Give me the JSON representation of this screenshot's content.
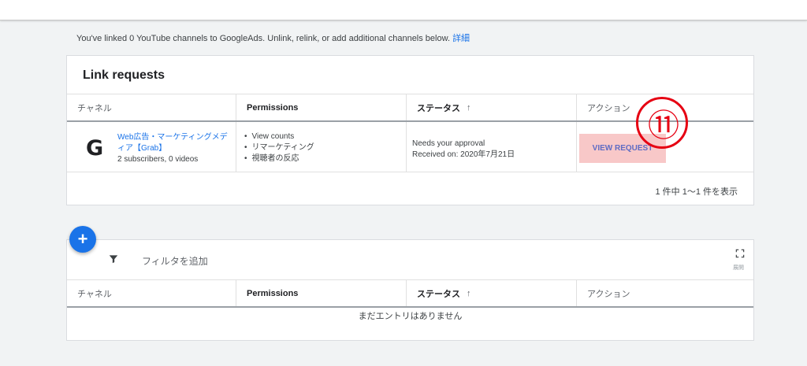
{
  "info": {
    "text": "You've linked 0 YouTube channels to GoogleAds. Unlink, relink, or add additional channels below.",
    "link": "詳細"
  },
  "link_requests": {
    "title": "Link requests",
    "columns": [
      "チャネル",
      "Permissions",
      "ステータス",
      "アクション"
    ],
    "sort_arrow": "↑",
    "row": {
      "logo": "G",
      "channel_name": "Web広告・マーケティングメディア【Grab】",
      "channel_stats": "2 subscribers, 0 videos",
      "permissions": [
        "View counts",
        "リマーケティング",
        "視聴者の反応"
      ],
      "status_line1": "Needs your approval",
      "status_line2": "Received on: 2020年7月21日",
      "action": "VIEW REQUEST"
    },
    "annotation": "⑪",
    "pagination": "1 件中 1～1 件を表示"
  },
  "linked_table": {
    "add_button": "+",
    "filter_placeholder": "フィルタを追加",
    "expand_label": "展開",
    "columns": [
      "チャネル",
      "Permissions",
      "ステータス",
      "アクション"
    ],
    "sort_arrow": "↑",
    "empty_message": "まだエントリはありません"
  },
  "colors": {
    "accent": "#1a73e8",
    "highlight": "#f8c8c8",
    "annotation": "#e60012"
  }
}
